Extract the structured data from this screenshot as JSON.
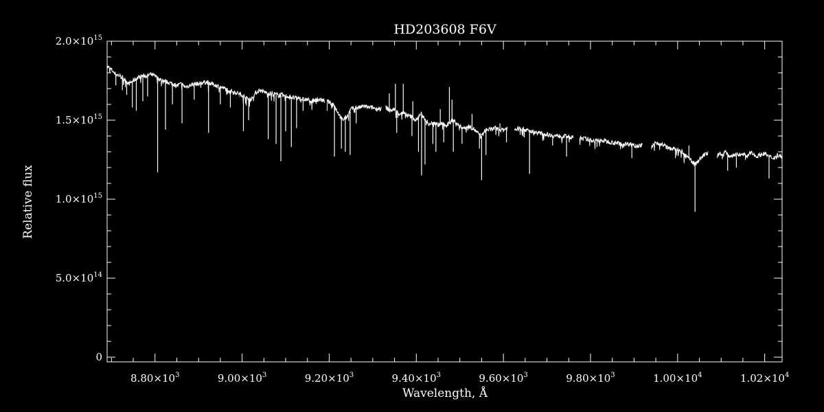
{
  "chart_data": {
    "type": "line",
    "title": "HD203608   F6V",
    "xlabel": "Wavelength, Å",
    "ylabel": "Relative flux",
    "xlim": [
      8690,
      10240
    ],
    "ylim": [
      -30000000000000.0,
      2000000000000000.0
    ],
    "grid": false,
    "colors": {
      "background": "#000000",
      "foreground": "#ffffff"
    },
    "x_ticks": [
      {
        "value": 8800,
        "mantissa": "8.80",
        "exponent": "3"
      },
      {
        "value": 9000,
        "mantissa": "9.00",
        "exponent": "3"
      },
      {
        "value": 9200,
        "mantissa": "9.20",
        "exponent": "3"
      },
      {
        "value": 9400,
        "mantissa": "9.40",
        "exponent": "3"
      },
      {
        "value": 9600,
        "mantissa": "9.60",
        "exponent": "3"
      },
      {
        "value": 9800,
        "mantissa": "9.80",
        "exponent": "3"
      },
      {
        "value": 10000,
        "mantissa": "1.00",
        "exponent": "4"
      },
      {
        "value": 10200,
        "mantissa": "1.02",
        "exponent": "4"
      }
    ],
    "y_ticks": [
      {
        "value": 0,
        "label": "0"
      },
      {
        "value": 500000000000000.0,
        "mantissa": "5.0",
        "exponent": "14"
      },
      {
        "value": 1000000000000000.0,
        "mantissa": "1.0",
        "exponent": "15"
      },
      {
        "value": 1500000000000000.0,
        "mantissa": "1.5",
        "exponent": "15"
      },
      {
        "value": 2000000000000000.0,
        "mantissa": "2.0",
        "exponent": "15"
      }
    ],
    "times_symbol": "×10",
    "series": [
      {
        "segments": [
          {
            "x": [
              8690,
              8700,
              8710,
              8720,
              8730,
              8740,
              8750,
              8760,
              8770,
              8780,
              8790,
              8800,
              8810,
              8820,
              8830,
              8840,
              8850,
              8860,
              8870,
              8880,
              8890,
              8900,
              8910,
              8920,
              8930,
              8940,
              8950,
              8960,
              8970,
              8980,
              8990,
              9000,
              9010,
              9020,
              9030,
              9040,
              9050,
              9060,
              9070,
              9080,
              9090,
              9100,
              9110,
              9120,
              9130,
              9140,
              9150,
              9160,
              9170,
              9180,
              9190
            ],
            "y": [
              1840000000000000.0,
              1820000000000000.0,
              1790000000000000.0,
              1780000000000000.0,
              1760000000000000.0,
              1730000000000000.0,
              1750000000000000.0,
              1770000000000000.0,
              1780000000000000.0,
              1780000000000000.0,
              1790000000000000.0,
              1780000000000000.0,
              1760000000000000.0,
              1750000000000000.0,
              1740000000000000.0,
              1730000000000000.0,
              1720000000000000.0,
              1730000000000000.0,
              1710000000000000.0,
              1720000000000000.0,
              1730000000000000.0,
              1730000000000000.0,
              1740000000000000.0,
              1740000000000000.0,
              1730000000000000.0,
              1720000000000000.0,
              1710000000000000.0,
              1700000000000000.0,
              1690000000000000.0,
              1680000000000000.0,
              1670000000000000.0,
              1660000000000000.0,
              1640000000000000.0,
              1630000000000000.0,
              1670000000000000.0,
              1690000000000000.0,
              1680000000000000.0,
              1670000000000000.0,
              1670000000000000.0,
              1660000000000000.0,
              1660000000000000.0,
              1650000000000000.0,
              1650000000000000.0,
              1640000000000000.0,
              1640000000000000.0,
              1630000000000000.0,
              1630000000000000.0,
              1620000000000000.0,
              1630000000000000.0,
              1630000000000000.0,
              1620000000000000.0
            ]
          },
          {
            "x": [
              9195,
              9210,
              9220,
              9230,
              9240,
              9250,
              9260,
              9270,
              9280,
              9290,
              9300,
              9310,
              9320
            ],
            "y": [
              1620000000000000.0,
              1600000000000000.0,
              1550000000000000.0,
              1500000000000000.0,
              1520000000000000.0,
              1570000000000000.0,
              1580000000000000.0,
              1580000000000000.0,
              1590000000000000.0,
              1580000000000000.0,
              1580000000000000.0,
              1570000000000000.0,
              1580000000000000.0
            ]
          },
          {
            "x": [
              9330,
              9340,
              9350,
              9360,
              9370,
              9380,
              9390,
              9400,
              9410,
              9420,
              9430,
              9440,
              9450,
              9460,
              9470,
              9480,
              9490,
              9500,
              9510,
              9520,
              9530,
              9540,
              9550,
              9560,
              9570,
              9580,
              9590,
              9600,
              9610
            ],
            "y": [
              1580000000000000.0,
              1560000000000000.0,
              1570000000000000.0,
              1540000000000000.0,
              1550000000000000.0,
              1530000000000000.0,
              1520000000000000.0,
              1500000000000000.0,
              1540000000000000.0,
              1510000000000000.0,
              1470000000000000.0,
              1490000000000000.0,
              1470000000000000.0,
              1480000000000000.0,
              1460000000000000.0,
              1500000000000000.0,
              1490000000000000.0,
              1460000000000000.0,
              1450000000000000.0,
              1460000000000000.0,
              1450000000000000.0,
              1420000000000000.0,
              1400000000000000.0,
              1440000000000000.0,
              1440000000000000.0,
              1450000000000000.0,
              1440000000000000.0,
              1440000000000000.0,
              1450000000000000.0
            ]
          },
          {
            "x": [
              9625,
              9640,
              9660,
              9680,
              9700,
              9720,
              9740,
              9760
            ],
            "y": [
              1440000000000000.0,
              1450000000000000.0,
              1430000000000000.0,
              1420000000000000.0,
              1410000000000000.0,
              1400000000000000.0,
              1400000000000000.0,
              1390000000000000.0
            ]
          },
          {
            "x": [
              9775,
              9790,
              9810,
              9830,
              9850,
              9870,
              9890,
              9910,
              9920
            ],
            "y": [
              1390000000000000.0,
              1380000000000000.0,
              1370000000000000.0,
              1370000000000000.0,
              1360000000000000.0,
              1350000000000000.0,
              1350000000000000.0,
              1340000000000000.0,
              1340000000000000.0
            ]
          },
          {
            "x": [
              9940,
              9950,
              9960,
              9970,
              9980,
              9990,
              10000,
              10010,
              10020,
              10030,
              10040,
              10050,
              10060,
              10070
            ],
            "y": [
              1330000000000000.0,
              1360000000000000.0,
              1350000000000000.0,
              1340000000000000.0,
              1320000000000000.0,
              1320000000000000.0,
              1310000000000000.0,
              1300000000000000.0,
              1270000000000000.0,
              1250000000000000.0,
              1220000000000000.0,
              1250000000000000.0,
              1280000000000000.0,
              1290000000000000.0
            ]
          },
          {
            "x": [
              10090,
              10100,
              10110,
              10120,
              10130,
              10140,
              10150,
              10160,
              10170,
              10180,
              10190,
              10200,
              10210,
              10220,
              10230,
              10240
            ],
            "y": [
              1270000000000000.0,
              1290000000000000.0,
              1300000000000000.0,
              1270000000000000.0,
              1280000000000000.0,
              1280000000000000.0,
              1290000000000000.0,
              1270000000000000.0,
              1300000000000000.0,
              1270000000000000.0,
              1280000000000000.0,
              1290000000000000.0,
              1270000000000000.0,
              1260000000000000.0,
              1280000000000000.0,
              1270000000000000.0
            ]
          }
        ],
        "absorption_lines": [
          {
            "x": 8710,
            "y": 1720000000000000.0
          },
          {
            "x": 8725,
            "y": 1690000000000000.0
          },
          {
            "x": 8735,
            "y": 1660000000000000.0
          },
          {
            "x": 8748,
            "y": 1580000000000000.0
          },
          {
            "x": 8757,
            "y": 1560000000000000.0
          },
          {
            "x": 8772,
            "y": 1620000000000000.0
          },
          {
            "x": 8783,
            "y": 1650000000000000.0
          },
          {
            "x": 8806,
            "y": 1170000000000000.0
          },
          {
            "x": 8824,
            "y": 1440000000000000.0
          },
          {
            "x": 8840,
            "y": 1600000000000000.0
          },
          {
            "x": 8862,
            "y": 1480000000000000.0
          },
          {
            "x": 8890,
            "y": 1630000000000000.0
          },
          {
            "x": 8923,
            "y": 1420000000000000.0
          },
          {
            "x": 8950,
            "y": 1600000000000000.0
          },
          {
            "x": 8973,
            "y": 1580000000000000.0
          },
          {
            "x": 9003,
            "y": 1430000000000000.0
          },
          {
            "x": 9015,
            "y": 1500000000000000.0
          },
          {
            "x": 9060,
            "y": 1380000000000000.0
          },
          {
            "x": 9078,
            "y": 1350000000000000.0
          },
          {
            "x": 9089,
            "y": 1240000000000000.0
          },
          {
            "x": 9100,
            "y": 1430000000000000.0
          },
          {
            "x": 9113,
            "y": 1330000000000000.0
          },
          {
            "x": 9125,
            "y": 1450000000000000.0
          },
          {
            "x": 9140,
            "y": 1560000000000000.0
          },
          {
            "x": 9212,
            "y": 1270000000000000.0
          },
          {
            "x": 9228,
            "y": 1320000000000000.0
          },
          {
            "x": 9237,
            "y": 1300000000000000.0
          },
          {
            "x": 9248,
            "y": 1280000000000000.0
          },
          {
            "x": 9262,
            "y": 1480000000000000.0
          },
          {
            "x": 9355,
            "y": 1420000000000000.0
          },
          {
            "x": 9390,
            "y": 1400000000000000.0
          },
          {
            "x": 9405,
            "y": 1300000000000000.0
          },
          {
            "x": 9412,
            "y": 1150000000000000.0
          },
          {
            "x": 9420,
            "y": 1220000000000000.0
          },
          {
            "x": 9438,
            "y": 1350000000000000.0
          },
          {
            "x": 9445,
            "y": 1300000000000000.0
          },
          {
            "x": 9463,
            "y": 1360000000000000.0
          },
          {
            "x": 9485,
            "y": 1300000000000000.0
          },
          {
            "x": 9505,
            "y": 1350000000000000.0
          },
          {
            "x": 9545,
            "y": 1320000000000000.0
          },
          {
            "x": 9550,
            "y": 1120000000000000.0
          },
          {
            "x": 9560,
            "y": 1280000000000000.0
          },
          {
            "x": 9607,
            "y": 1360000000000000.0
          },
          {
            "x": 9648,
            "y": 1390000000000000.0
          },
          {
            "x": 9660,
            "y": 1160000000000000.0
          },
          {
            "x": 9713,
            "y": 1340000000000000.0
          },
          {
            "x": 9745,
            "y": 1270000000000000.0
          },
          {
            "x": 9815,
            "y": 1330000000000000.0
          },
          {
            "x": 9895,
            "y": 1260000000000000.0
          },
          {
            "x": 9995,
            "y": 1260000000000000.0
          },
          {
            "x": 10040,
            "y": 920000000000000.0
          },
          {
            "x": 10115,
            "y": 1180000000000000.0
          },
          {
            "x": 10135,
            "y": 1200000000000000.0
          },
          {
            "x": 10210,
            "y": 1130000000000000.0
          }
        ],
        "emission_spikes": [
          {
            "x": 9338,
            "y": 1670000000000000.0
          },
          {
            "x": 9352,
            "y": 1730000000000000.0
          },
          {
            "x": 9370,
            "y": 1730000000000000.0
          },
          {
            "x": 9476,
            "y": 1710000000000000.0
          },
          {
            "x": 9482,
            "y": 1630000000000000.0
          },
          {
            "x": 9392,
            "y": 1620000000000000.0
          },
          {
            "x": 9528,
            "y": 1540000000000000.0
          },
          {
            "x": 9455,
            "y": 1570000000000000.0
          },
          {
            "x": 9592,
            "y": 1480000000000000.0
          },
          {
            "x": 10026,
            "y": 1340000000000000.0
          }
        ]
      }
    ]
  }
}
